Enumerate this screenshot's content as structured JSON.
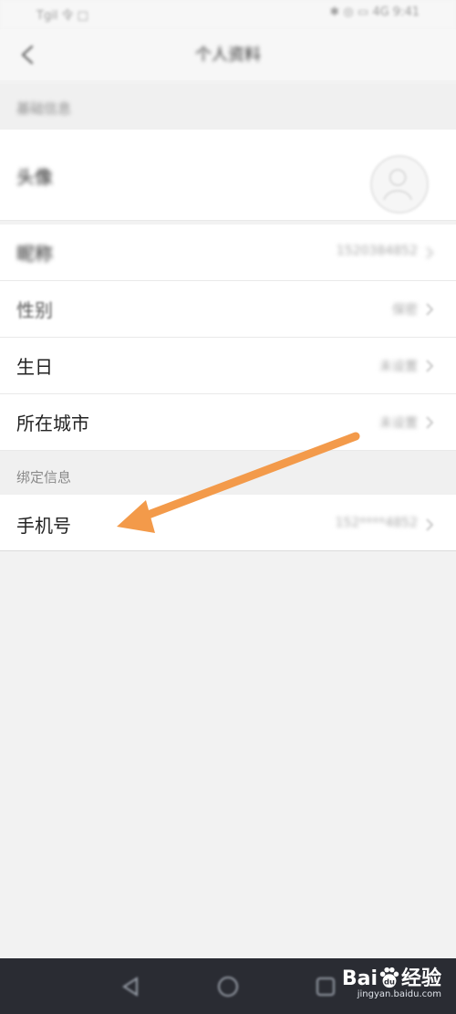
{
  "status_bar": {
    "left_text": "Tgil 令 □",
    "right_text": "✱ ◎ ▭ 4G 9:41"
  },
  "nav": {
    "title": "个人资料"
  },
  "sections": [
    {
      "header": "基础信息"
    },
    {
      "header": "绑定信息"
    }
  ],
  "rows": {
    "avatar": {
      "label": "头像"
    },
    "nickname": {
      "label": "昵称",
      "value": "1520384852"
    },
    "gender": {
      "label": "性别",
      "value": "保密"
    },
    "birthday": {
      "label": "生日",
      "value": "未设置"
    },
    "city": {
      "label": "所在城市",
      "value": "未设置"
    },
    "phone": {
      "label": "手机号",
      "value": "152****4852"
    }
  },
  "watermark": {
    "brand_prefix": "Bai",
    "brand_mid": "du",
    "brand_suffix": "经验",
    "url": "jingyan.baidu.com"
  },
  "colors": {
    "arrow": "#f39a4a",
    "bottom_nav_bg": "#2a2c33"
  },
  "icons": [
    "back-arrow-icon",
    "chevron-right-icon",
    "avatar-placeholder-icon",
    "nav-back-triangle-icon",
    "nav-home-circle-icon",
    "nav-recent-square-icon",
    "annotation-arrow-icon",
    "baidu-paw-icon"
  ]
}
